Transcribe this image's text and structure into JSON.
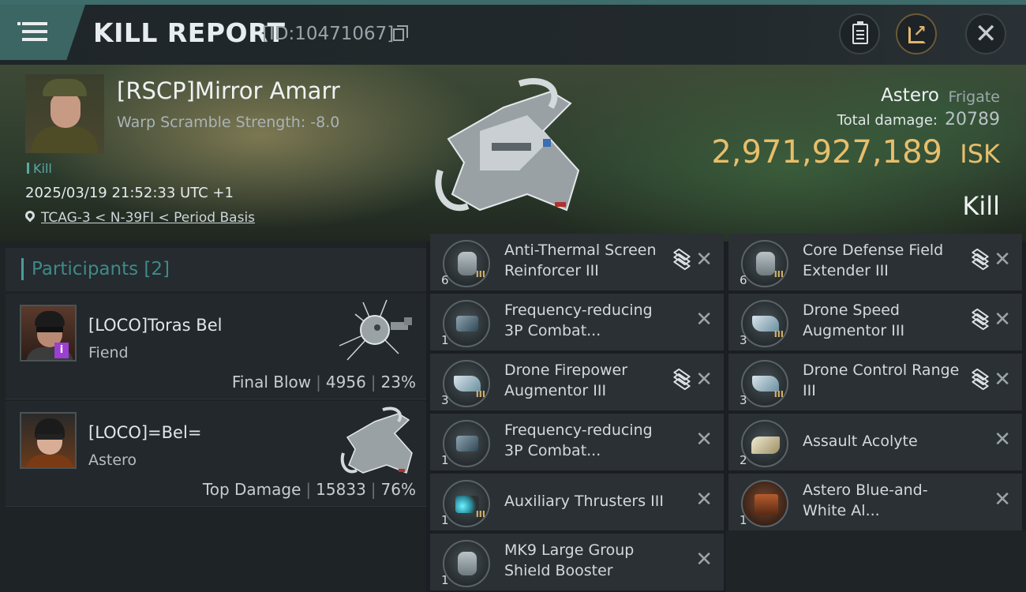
{
  "header": {
    "title": "KILL REPORT",
    "report_id": "[ID:10471067]",
    "buttons": {
      "menu": "menu-icon",
      "clipboard": "clipboard-icon",
      "share": "share-icon",
      "close": "close-icon"
    }
  },
  "victim": {
    "name": "[RSCP]Mirror Amarr",
    "warp_scramble": "Warp Scramble Strength: -8.0",
    "tag": "Kill",
    "timestamp": "2025/03/19 21:52:33 UTC +1",
    "location": "TCAG-3 < N-39FI < Period Basis"
  },
  "ship": {
    "name": "Astero",
    "class": "Frigate",
    "total_damage_label": "Total damage:",
    "total_damage": "20789",
    "isk_value": "2,971,927,189",
    "isk_unit": "ISK",
    "result": "Kill"
  },
  "participants": {
    "label": "Participants [2]",
    "rows": [
      {
        "name": "[LOCO]Toras Bel",
        "ship": "Fiend",
        "role": "Final Blow",
        "damage": "4956",
        "percent": "23%"
      },
      {
        "name": "[LOCO]=Bel=",
        "ship": "Astero",
        "role": "Top Damage",
        "damage": "15833",
        "percent": "76%"
      }
    ]
  },
  "modules": {
    "left": [
      {
        "qty": "6",
        "name": "Anti-Thermal Screen Reinforcer III",
        "stack": true
      },
      {
        "qty": "1",
        "name": "Frequency-reducing 3P Combat...",
        "stack": false
      },
      {
        "qty": "3",
        "name": "Drone Firepower Augmentor III",
        "stack": true
      },
      {
        "qty": "1",
        "name": "Frequency-reducing 3P Combat...",
        "stack": false
      },
      {
        "qty": "1",
        "name": "Auxiliary Thrusters III",
        "stack": false
      },
      {
        "qty": "1",
        "name": "MK9 Large Group Shield Booster",
        "stack": false
      }
    ],
    "right": [
      {
        "qty": "6",
        "name": "Core Defense Field Extender III",
        "stack": true
      },
      {
        "qty": "3",
        "name": "Drone Speed Augmentor III",
        "stack": true
      },
      {
        "qty": "3",
        "name": "Drone Control Range III",
        "stack": true
      },
      {
        "qty": "2",
        "name": "Assault Acolyte",
        "stack": false
      },
      {
        "qty": "1",
        "name": "Astero Blue-and-White Al...",
        "stack": false
      }
    ]
  },
  "colors": {
    "accent_teal": "#3b6664",
    "isk_gold": "#e8be6b",
    "badge_purple": "#9b3fd1"
  }
}
